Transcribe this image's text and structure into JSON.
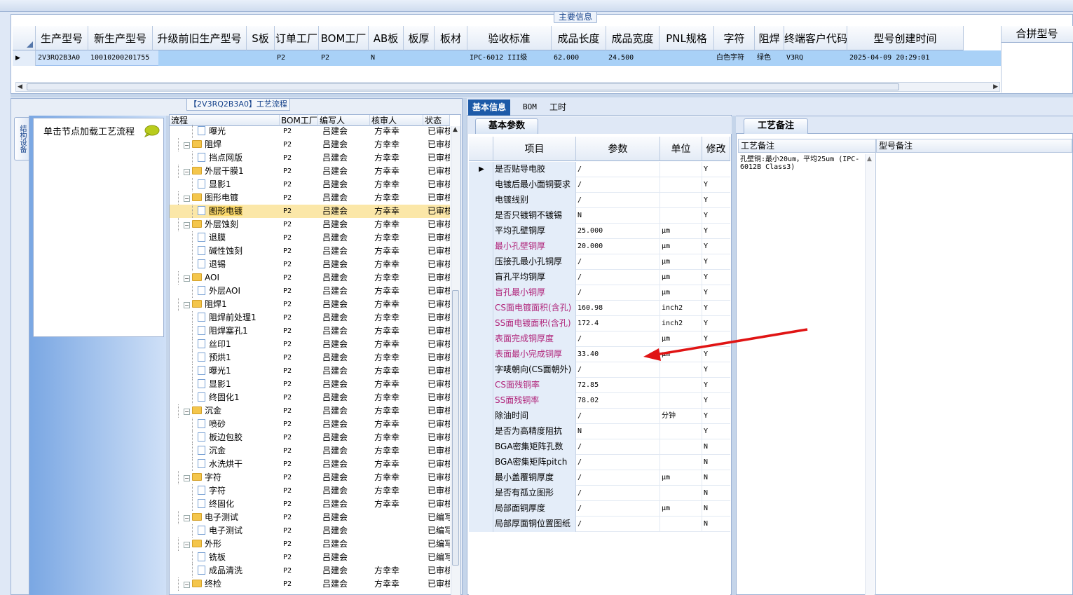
{
  "main_info": {
    "title": "主要信息",
    "columns": [
      "生产型号",
      "新生产型号",
      "升级前旧生产型号",
      "S板",
      "订单工厂",
      "BOM工厂",
      "AB板",
      "板厚",
      "板材",
      "验收标准",
      "成品长度",
      "成品宽度",
      "PNL规格",
      "字符",
      "阻焊",
      "终端客户代码",
      "型号创建时间"
    ],
    "row": [
      "2V3RQ2B3A0",
      "10010200201755",
      "",
      "",
      "P2",
      "P2",
      "N",
      "",
      "",
      "IPC-6012 III级",
      "62.000",
      "24.500",
      "",
      "白色字符",
      "绿色",
      "V3RQ",
      "2025-04-09 20:29:01"
    ],
    "merge_label": "合拼型号"
  },
  "flow": {
    "title": "【2V3RQ2B3A0】工艺流程",
    "side_tab": "结构设备",
    "load_text": "单击节点加载工艺流程",
    "headers": [
      "流程",
      "BOM工厂",
      "编写人",
      "核审人",
      "状态"
    ],
    "rows": [
      {
        "name": "曝光",
        "folder": false,
        "bom": "P2",
        "writer": "吕建会",
        "reviewer": "方幸幸",
        "status": "已审核"
      },
      {
        "name": "阻焊",
        "folder": true,
        "bom": "P2",
        "writer": "吕建会",
        "reviewer": "方幸幸",
        "status": "已审核"
      },
      {
        "name": "挡点网版",
        "folder": false,
        "bom": "P2",
        "writer": "吕建会",
        "reviewer": "方幸幸",
        "status": "已审核"
      },
      {
        "name": "外层干膜1",
        "folder": true,
        "bom": "P2",
        "writer": "吕建会",
        "reviewer": "方幸幸",
        "status": "已审核"
      },
      {
        "name": "显影1",
        "folder": false,
        "bom": "P2",
        "writer": "吕建会",
        "reviewer": "方幸幸",
        "status": "已审核"
      },
      {
        "name": "图形电镀",
        "folder": true,
        "bom": "P2",
        "writer": "吕建会",
        "reviewer": "方幸幸",
        "status": "已审核"
      },
      {
        "name": "图形电镀",
        "folder": false,
        "bom": "P2",
        "writer": "吕建会",
        "reviewer": "方幸幸",
        "status": "已审核",
        "selected": true
      },
      {
        "name": "外层蚀刻",
        "folder": true,
        "bom": "P2",
        "writer": "吕建会",
        "reviewer": "方幸幸",
        "status": "已审核"
      },
      {
        "name": "退膜",
        "folder": false,
        "bom": "P2",
        "writer": "吕建会",
        "reviewer": "方幸幸",
        "status": "已审核"
      },
      {
        "name": "碱性蚀刻",
        "folder": false,
        "bom": "P2",
        "writer": "吕建会",
        "reviewer": "方幸幸",
        "status": "已审核"
      },
      {
        "name": "退锡",
        "folder": false,
        "bom": "P2",
        "writer": "吕建会",
        "reviewer": "方幸幸",
        "status": "已审核"
      },
      {
        "name": "AOI",
        "folder": true,
        "bom": "P2",
        "writer": "吕建会",
        "reviewer": "方幸幸",
        "status": "已审核"
      },
      {
        "name": "外层AOI",
        "folder": false,
        "bom": "P2",
        "writer": "吕建会",
        "reviewer": "方幸幸",
        "status": "已审核"
      },
      {
        "name": "阻焊1",
        "folder": true,
        "bom": "P2",
        "writer": "吕建会",
        "reviewer": "方幸幸",
        "status": "已审核"
      },
      {
        "name": "阻焊前处理1",
        "folder": false,
        "bom": "P2",
        "writer": "吕建会",
        "reviewer": "方幸幸",
        "status": "已审核"
      },
      {
        "name": "阻焊塞孔1",
        "folder": false,
        "bom": "P2",
        "writer": "吕建会",
        "reviewer": "方幸幸",
        "status": "已审核"
      },
      {
        "name": "丝印1",
        "folder": false,
        "bom": "P2",
        "writer": "吕建会",
        "reviewer": "方幸幸",
        "status": "已审核"
      },
      {
        "name": "预烘1",
        "folder": false,
        "bom": "P2",
        "writer": "吕建会",
        "reviewer": "方幸幸",
        "status": "已审核"
      },
      {
        "name": "曝光1",
        "folder": false,
        "bom": "P2",
        "writer": "吕建会",
        "reviewer": "方幸幸",
        "status": "已审核"
      },
      {
        "name": "显影1",
        "folder": false,
        "bom": "P2",
        "writer": "吕建会",
        "reviewer": "方幸幸",
        "status": "已审核"
      },
      {
        "name": "终固化1",
        "folder": false,
        "bom": "P2",
        "writer": "吕建会",
        "reviewer": "方幸幸",
        "status": "已审核"
      },
      {
        "name": "沉金",
        "folder": true,
        "bom": "P2",
        "writer": "吕建会",
        "reviewer": "方幸幸",
        "status": "已审核"
      },
      {
        "name": "喷砂",
        "folder": false,
        "bom": "P2",
        "writer": "吕建会",
        "reviewer": "方幸幸",
        "status": "已审核"
      },
      {
        "name": "板边包胶",
        "folder": false,
        "bom": "P2",
        "writer": "吕建会",
        "reviewer": "方幸幸",
        "status": "已审核"
      },
      {
        "name": "沉金",
        "folder": false,
        "bom": "P2",
        "writer": "吕建会",
        "reviewer": "方幸幸",
        "status": "已审核"
      },
      {
        "name": "水洗烘干",
        "folder": false,
        "bom": "P2",
        "writer": "吕建会",
        "reviewer": "方幸幸",
        "status": "已审核"
      },
      {
        "name": "字符",
        "folder": true,
        "bom": "P2",
        "writer": "吕建会",
        "reviewer": "方幸幸",
        "status": "已审核"
      },
      {
        "name": "字符",
        "folder": false,
        "bom": "P2",
        "writer": "吕建会",
        "reviewer": "方幸幸",
        "status": "已审核"
      },
      {
        "name": "终固化",
        "folder": false,
        "bom": "P2",
        "writer": "吕建会",
        "reviewer": "方幸幸",
        "status": "已审核"
      },
      {
        "name": "电子测试",
        "folder": true,
        "bom": "P2",
        "writer": "吕建会",
        "reviewer": "",
        "status": "已编写"
      },
      {
        "name": "电子测试",
        "folder": false,
        "bom": "P2",
        "writer": "吕建会",
        "reviewer": "",
        "status": "已编写"
      },
      {
        "name": "外形",
        "folder": true,
        "bom": "P2",
        "writer": "吕建会",
        "reviewer": "",
        "status": "已编写"
      },
      {
        "name": "铣板",
        "folder": false,
        "bom": "P2",
        "writer": "吕建会",
        "reviewer": "",
        "status": "已编写"
      },
      {
        "name": "成品清洗",
        "folder": false,
        "bom": "P2",
        "writer": "吕建会",
        "reviewer": "方幸幸",
        "status": "已审核"
      },
      {
        "name": "终检",
        "folder": true,
        "bom": "P2",
        "writer": "吕建会",
        "reviewer": "方幸幸",
        "status": "已审核"
      }
    ]
  },
  "middle": {
    "tabs": [
      "基本信息",
      "BOM",
      "工时"
    ],
    "subtab": "基本参数",
    "headers": [
      "项目",
      "参数",
      "单位",
      "修改"
    ],
    "rows": [
      {
        "item": "是否贴导电胶",
        "param": "/",
        "unit": "",
        "mod": "Y",
        "pink": false,
        "current": true
      },
      {
        "item": "电镀后最小面铜要求",
        "param": "/",
        "unit": "",
        "mod": "Y",
        "pink": false
      },
      {
        "item": "电镀线别",
        "param": "/",
        "unit": "",
        "mod": "Y",
        "pink": false
      },
      {
        "item": "是否只镀铜不镀锡",
        "param": "N",
        "unit": "",
        "mod": "Y",
        "pink": false
      },
      {
        "item": "平均孔壁铜厚",
        "param": "25.000",
        "unit": "μm",
        "mod": "Y",
        "pink": false
      },
      {
        "item": "最小孔壁铜厚",
        "param": "20.000",
        "unit": "μm",
        "mod": "Y",
        "pink": true
      },
      {
        "item": "压接孔最小孔铜厚",
        "param": "/",
        "unit": "μm",
        "mod": "Y",
        "pink": false
      },
      {
        "item": "盲孔平均铜厚",
        "param": "/",
        "unit": "μm",
        "mod": "Y",
        "pink": false
      },
      {
        "item": "盲孔最小铜厚",
        "param": "/",
        "unit": "μm",
        "mod": "Y",
        "pink": true
      },
      {
        "item": "CS面电镀面积(含孔)",
        "param": "160.98",
        "unit": "inch2",
        "mod": "Y",
        "pink": true
      },
      {
        "item": "SS面电镀面积(含孔)",
        "param": "172.4",
        "unit": "inch2",
        "mod": "Y",
        "pink": true
      },
      {
        "item": "表面完成铜厚度",
        "param": "/",
        "unit": "μm",
        "mod": "Y",
        "pink": true
      },
      {
        "item": "表面最小完成铜厚",
        "param": "33.40",
        "unit": "μm",
        "mod": "Y",
        "pink": true
      },
      {
        "item": "字唛朝向(CS面朝外)",
        "param": "/",
        "unit": "",
        "mod": "Y",
        "pink": false
      },
      {
        "item": "CS面残铜率",
        "param": "72.85",
        "unit": "",
        "mod": "Y",
        "pink": true
      },
      {
        "item": "SS面残铜率",
        "param": "78.02",
        "unit": "",
        "mod": "Y",
        "pink": true
      },
      {
        "item": "除油时间",
        "param": "/",
        "unit": "分钟",
        "mod": "Y",
        "pink": false
      },
      {
        "item": "是否为高精度阻抗",
        "param": "N",
        "unit": "",
        "mod": "Y",
        "pink": false
      },
      {
        "item": "BGA密集矩阵孔数",
        "param": "/",
        "unit": "",
        "mod": "N",
        "pink": false
      },
      {
        "item": "BGA密集矩阵pitch",
        "param": "/",
        "unit": "",
        "mod": "N",
        "pink": false
      },
      {
        "item": "最小盖覆铜厚度",
        "param": "/",
        "unit": "μm",
        "mod": "N",
        "pink": false
      },
      {
        "item": "是否有孤立图形",
        "param": "/",
        "unit": "",
        "mod": "N",
        "pink": false
      },
      {
        "item": "局部面铜厚度",
        "param": "/",
        "unit": "μm",
        "mod": "N",
        "pink": false
      },
      {
        "item": "局部厚面铜位置图纸",
        "param": "/",
        "unit": "",
        "mod": "N",
        "pink": false
      }
    ]
  },
  "right": {
    "tab": "工艺备注",
    "col1": "工艺备注",
    "col2": "型号备注",
    "note": "孔壁铜:最小20um，平均25um (IPC-6012B Class3)"
  },
  "colors": {
    "pink_text": "#b0247a",
    "selected_row": "#a9d1f7",
    "tab_active": "#1d5aa8",
    "arrow": "#e01414"
  }
}
